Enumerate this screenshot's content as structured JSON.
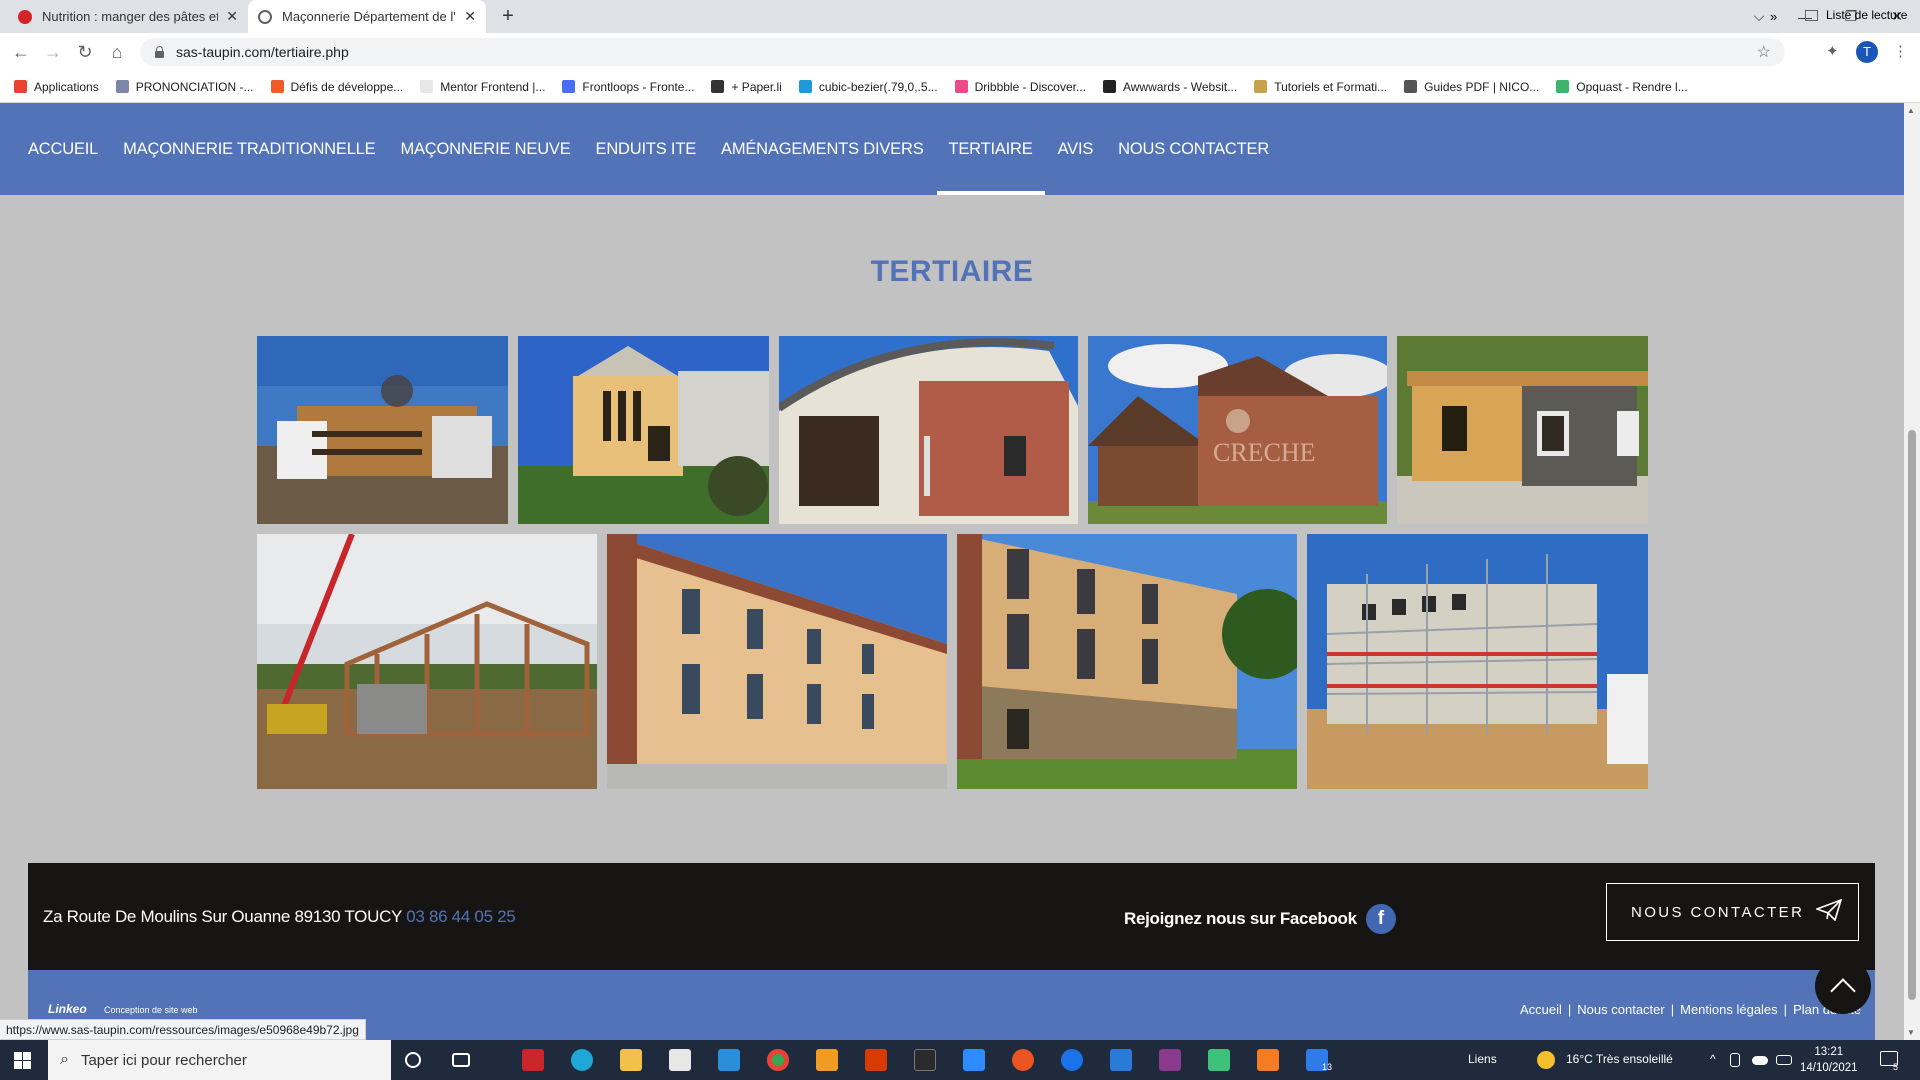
{
  "browser": {
    "tabs": [
      {
        "title": "Nutrition : manger des pâtes et c",
        "close": "✕"
      },
      {
        "title": "Maçonnerie Département de l'Yo",
        "close": "✕"
      }
    ],
    "new_tab": "+",
    "window_controls": {
      "dropdown": "⌵",
      "minimize": "—",
      "maximize": "❐",
      "close": "✕"
    },
    "nav": {
      "back": "←",
      "forward": "→",
      "reload": "↻",
      "home": "⌂"
    },
    "url": "sas-taupin.com/tertiaire.php",
    "star": "☆",
    "extensions": "✦",
    "profile_initial": "T",
    "menu": "⋮",
    "bookmarks": [
      {
        "label": "Applications",
        "color": "#e94235"
      },
      {
        "label": "PRONONCIATION -...",
        "color": "#7c86a8"
      },
      {
        "label": "Défis de développe...",
        "color": "#f05a28"
      },
      {
        "label": "Mentor Frontend |...",
        "color": "#e8e8e8"
      },
      {
        "label": "Frontloops - Fronte...",
        "color": "#4a6cf7"
      },
      {
        "label": "+ Paper.li",
        "color": "#333333"
      },
      {
        "label": "cubic-bezier(.79,0,.5...",
        "color": "#1e9bd7"
      },
      {
        "label": "Dribbble - Discover...",
        "color": "#ea4c89"
      },
      {
        "label": "Awwwards - Websit...",
        "color": "#222222"
      },
      {
        "label": "Tutoriels et Formati...",
        "color": "#c8a24b"
      },
      {
        "label": "Guides PDF | NICO...",
        "color": "#555555"
      },
      {
        "label": "Opquast - Rendre l...",
        "color": "#3db36b"
      }
    ],
    "bookmarks_more": "»",
    "reading_list": "Liste de lecture",
    "status_url": "https://www.sas-taupin.com/ressources/images/e50968e49b72.jpg"
  },
  "site": {
    "nav": [
      {
        "label": "ACCUEIL",
        "active": false
      },
      {
        "label": "MAÇONNERIE TRADITIONNELLE",
        "active": false
      },
      {
        "label": "MAÇONNERIE NEUVE",
        "active": false
      },
      {
        "label": "ENDUITS ITE",
        "active": false
      },
      {
        "label": "AMÉNAGEMENTS DIVERS",
        "active": false
      },
      {
        "label": "TERTIAIRE",
        "active": true
      },
      {
        "label": "AVIS",
        "active": false
      },
      {
        "label": "NOUS CONTACTER",
        "active": false
      }
    ],
    "page_title": "TERTIAIRE",
    "gallery": [
      {
        "name": "photo-office-building-wood-cladding"
      },
      {
        "name": "photo-yellow-building-with-windows"
      },
      {
        "name": "photo-curved-roof-brick-building"
      },
      {
        "name": "photo-creche-building"
      },
      {
        "name": "photo-building-under-construction-stone"
      },
      {
        "name": "photo-timber-frame-with-crane"
      },
      {
        "name": "photo-brick-school-building"
      },
      {
        "name": "photo-brick-building-stone-base"
      },
      {
        "name": "photo-scaffolding-construction"
      }
    ],
    "footer": {
      "address": "Za Route De Moulins Sur Ouanne 89130 TOUCY",
      "phone": "03 86 44 05 25",
      "facebook_text": "Rejoignez nous sur Facebook",
      "facebook_icon": "f",
      "contact_button": "NOUS CONTACTER",
      "credit_logo": "Linkeo",
      "credit_text": "Conception de site web",
      "legal_links": [
        "Accueil",
        "Nous contacter",
        "Mentions légales",
        "Plan du site"
      ]
    },
    "colors": {
      "brand_blue": "#5273b8",
      "footer_dark": "#161513",
      "page_bg": "#c2c2c2"
    }
  },
  "taskbar": {
    "search_placeholder": "Taper ici pour rechercher",
    "links_label": "Liens",
    "weather": "16°C  Très ensoleillé",
    "time": "13:21",
    "date": "14/10/2021",
    "badge_count": "13",
    "notif_count": "5"
  }
}
